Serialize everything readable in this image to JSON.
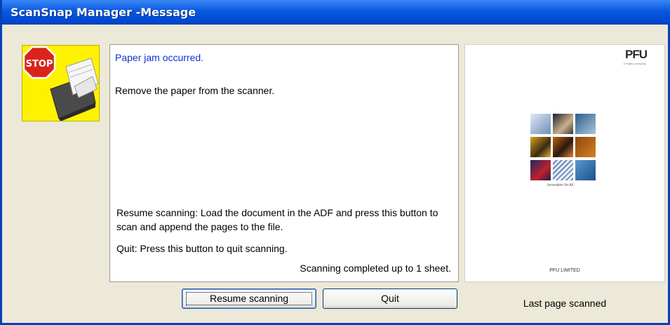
{
  "window": {
    "title": "ScanSnap Manager -Message"
  },
  "icon": {
    "name": "stop-paper-jam-icon",
    "stop_sign_text": "STOP"
  },
  "message": {
    "title": "Paper jam occurred.",
    "body": "Remove the paper from the scanner.",
    "resume_help": "Resume scanning: Load the document in the ADF and press this button to scan and append the pages to the file.",
    "quit_help": "Quit: Press this button to quit scanning.",
    "status": "Scanning completed up to 1 sheet."
  },
  "preview": {
    "logo_text": "PFU",
    "logo_subtext": "a Fujitsu company",
    "company_text": "PFU LIMITED",
    "tiles_caption": "Innovation for All",
    "caption": "Last page scanned"
  },
  "buttons": {
    "resume_label": "Resume scanning",
    "quit_label": "Quit"
  },
  "colors": {
    "titlebar": "#0858e0",
    "dialog_bg": "#ece9d8",
    "message_title": "#1430d0",
    "stop_red": "#d8241c",
    "icon_bg": "#fff200"
  }
}
